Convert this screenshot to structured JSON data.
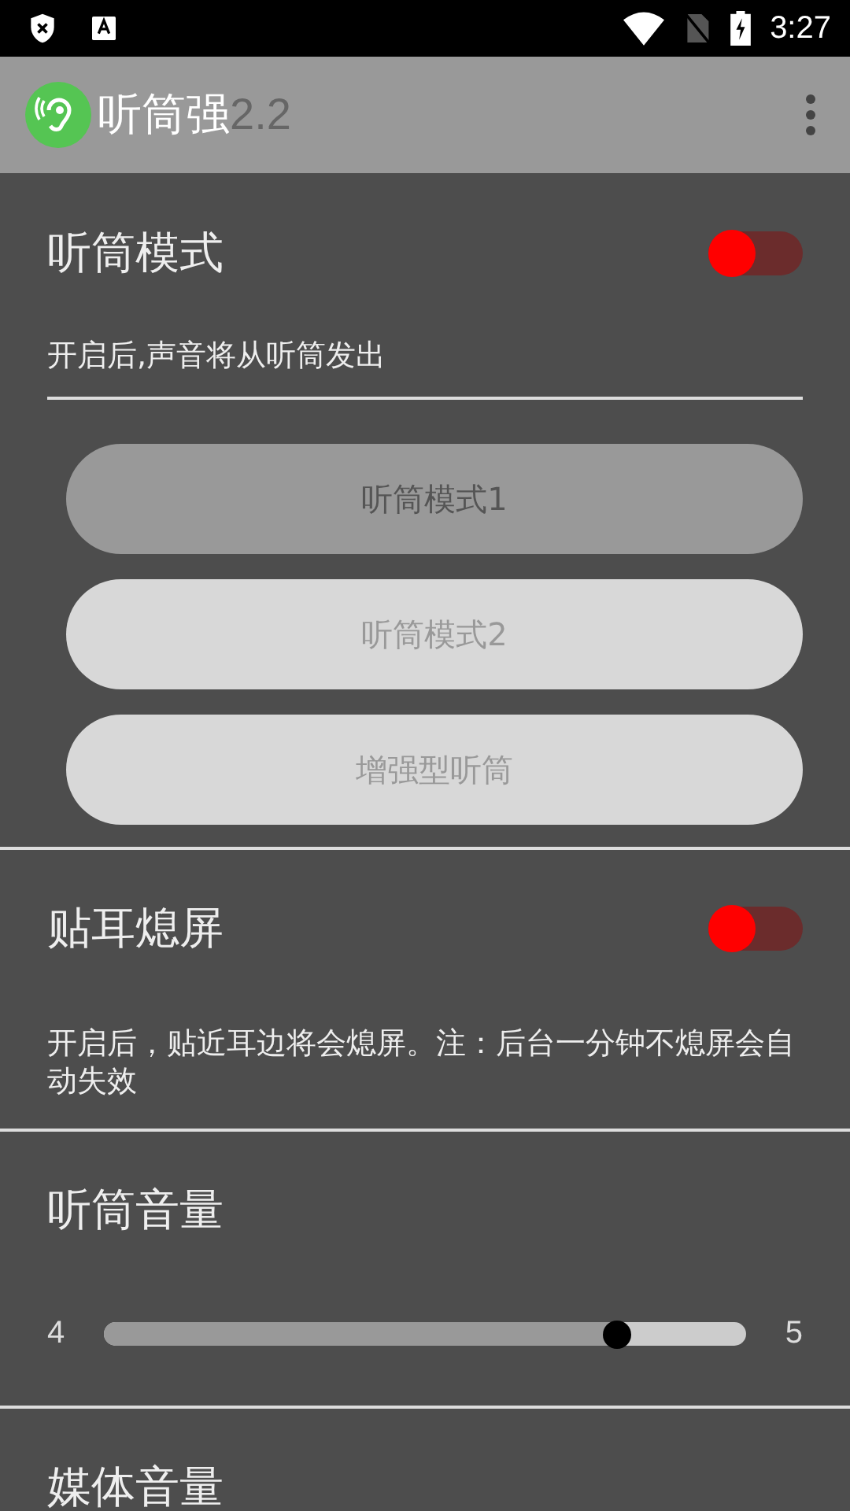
{
  "status_bar": {
    "time": "3:27"
  },
  "app_bar": {
    "title": "听筒强",
    "version": "2.2"
  },
  "sections": [
    {
      "kind": "toggle",
      "title": "听筒模式",
      "on": false,
      "description": "开启后,声音将从听筒发出",
      "options": [
        {
          "label": "听筒模式1",
          "selected": true
        },
        {
          "label": "听筒模式2",
          "selected": false
        },
        {
          "label": "增强型听筒",
          "selected": false
        }
      ]
    },
    {
      "kind": "toggle",
      "title": "贴耳熄屏",
      "on": false,
      "description": "开启后，贴近耳边将会熄屏。注：后台一分钟不熄屏会自动失效"
    },
    {
      "kind": "slider",
      "title": "听筒音量",
      "min_label": "4",
      "max_label": "5",
      "level": 0.8
    },
    {
      "kind": "slider",
      "title": "媒体音量"
    }
  ]
}
